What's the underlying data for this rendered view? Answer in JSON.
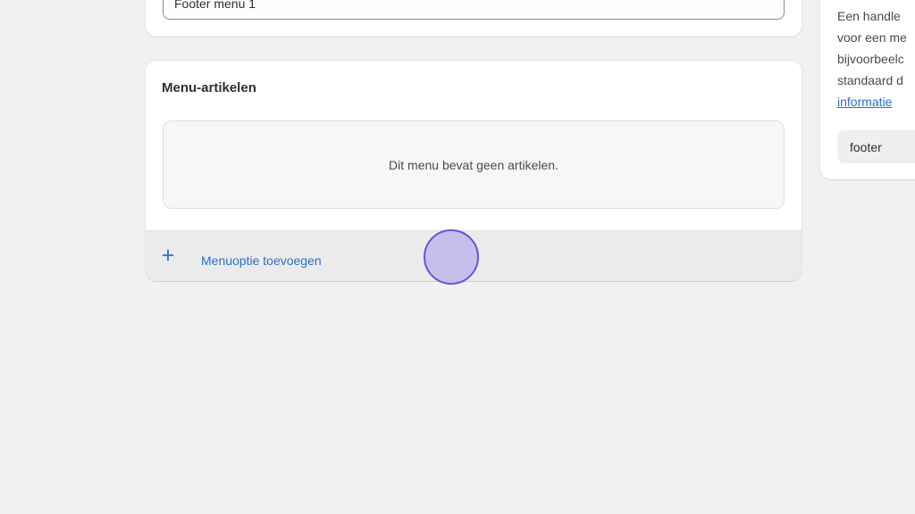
{
  "title_field": {
    "value": "Footer menu 1"
  },
  "menu_items": {
    "heading": "Menu-artikelen",
    "empty_message": "Dit menu bevat geen artikelen.",
    "add_label": "Menuoptie toevoegen",
    "add_icon": "plus-icon"
  },
  "handle_panel": {
    "description_lines": [
      "Een handle",
      "voor een me",
      "bijvoorbeelc",
      "standaard d"
    ],
    "link_text": "informatie",
    "handle_value": "footer"
  },
  "colors": {
    "accent_link": "#2c6ecb",
    "background": "#f1f1f1",
    "click_marker": "#6b4fe0"
  }
}
